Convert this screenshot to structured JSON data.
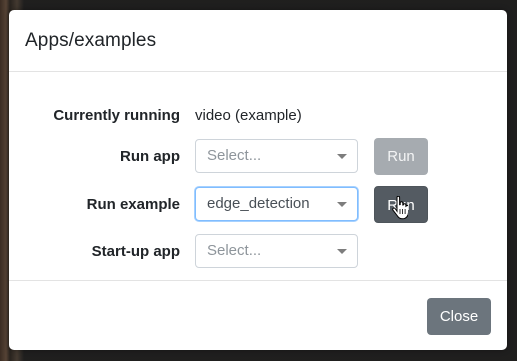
{
  "dialog": {
    "title": "Apps/examples"
  },
  "rows": {
    "currently_running": {
      "label": "Currently running",
      "value": "video (example)"
    },
    "run_app": {
      "label": "Run app",
      "select_placeholder": "Select...",
      "button_label": "Run",
      "button_state": "disabled"
    },
    "run_example": {
      "label": "Run example",
      "select_value": "edge_detection",
      "button_label": "Run",
      "button_state": "active"
    },
    "startup_app": {
      "label": "Start-up app",
      "select_placeholder": "Select..."
    }
  },
  "footer": {
    "close_label": "Close"
  },
  "colors": {
    "secondary_button": "#6c757d",
    "disabled_button": "#a6abb0",
    "focus_border": "#80bdff"
  },
  "icons": {
    "cursor": "hand-pointer-icon",
    "dropdown": "caret-down-icon"
  }
}
